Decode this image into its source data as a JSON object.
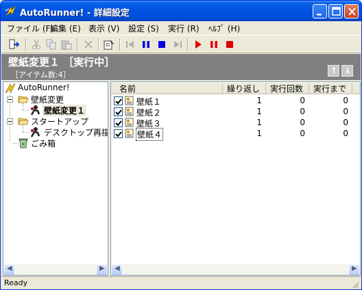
{
  "window": {
    "title": "AutoRunner! - 詳細設定",
    "icon": "autorunner-app-icon"
  },
  "menu": [
    "ファイル (F)",
    "編集 (E)",
    "表示 (V)",
    "設定 (S)",
    "実行 (R)",
    "ﾍﾙﾌﾟ (H)"
  ],
  "header": {
    "title": "壁紙変更１ ［実行中］",
    "subtitle": "［アイテム数:4］",
    "up_glyph": "↑",
    "down_glyph": "↓"
  },
  "tree": {
    "root": "AutoRunner!",
    "folders": [
      {
        "label": "壁紙変更",
        "children": [
          "壁紙変更１"
        ]
      },
      {
        "label": "スタートアップ",
        "children": [
          "デスクトップ再描"
        ]
      }
    ],
    "trash": "ごみ箱",
    "selected": "壁紙変更１"
  },
  "list": {
    "columns": [
      "名前",
      "繰り返し",
      "実行回数",
      "実行まで"
    ],
    "rows": [
      {
        "name": "壁紙１",
        "checked": true,
        "repeat": "1",
        "count": "0",
        "until": "0"
      },
      {
        "name": "壁紙２",
        "checked": true,
        "repeat": "1",
        "count": "0",
        "until": "0"
      },
      {
        "name": "壁紙３",
        "checked": true,
        "repeat": "1",
        "count": "0",
        "until": "0"
      },
      {
        "name": "壁紙４",
        "checked": true,
        "repeat": "1",
        "count": "0",
        "until": "0"
      }
    ]
  },
  "status": "Ready",
  "colors": {
    "titlebar": "#0054e3",
    "header_bg": "#808080",
    "play_red": "#e00000",
    "pause_blue": "#0000e0"
  }
}
